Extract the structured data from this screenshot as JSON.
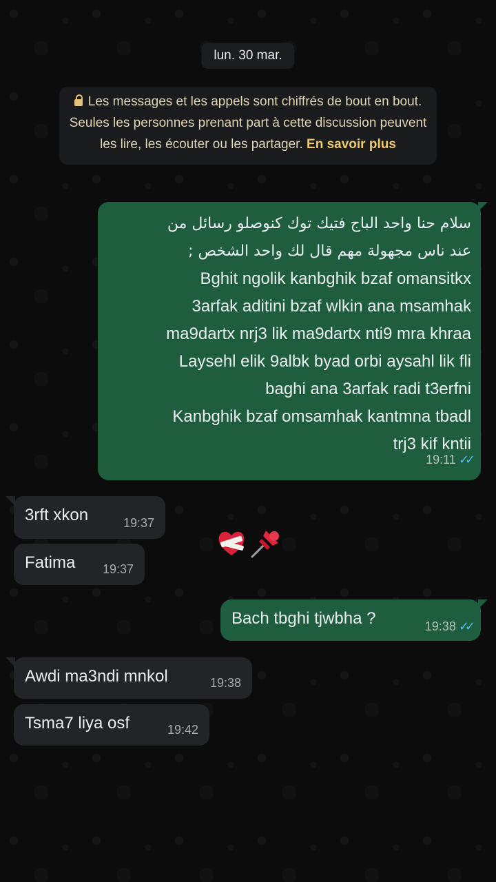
{
  "date_separator": "lun. 30 mar.",
  "encryption_notice": {
    "text": "Les messages et les appels sont chiffrés de bout en bout. Seules les personnes prenant part à cette discussion peuvent les lire, les écouter ou les partager.",
    "link": "En savoir plus"
  },
  "messages": [
    {
      "direction": "outgoing",
      "lines_arabic": [
        "سلام حنا واحد الباج فتيك توك كنوصلو رسائل من",
        "عند ناس مجهولة مهم قال لك واحد الشخص ;"
      ],
      "lines_latin": [
        "Bghit ngolik kanbghik bzaf omansitkx",
        "3arfak aditini bzaf wlkin ana msamhak",
        "ma9dartx nrj3 lik ma9dartx nti9 mra khraa",
        "Laysehl elik 9albk byad orbi aysahl lik fli",
        "baghi ana 3arfak radi t3erfni",
        "Kanbghik bzaf omsamhak kantmna tbadl",
        "trj3 kif kntii"
      ],
      "time": "19:11",
      "status": "read"
    },
    {
      "direction": "incoming",
      "text": "3rft xkon",
      "time": "19:37"
    },
    {
      "direction": "incoming",
      "text": "Fatima",
      "time": "19:37"
    },
    {
      "direction": "outgoing",
      "text": "Bach tbghi tjwbha ?",
      "time": "19:38",
      "status": "read"
    },
    {
      "direction": "incoming",
      "text": "Awdi ma3ndi mnkol",
      "time": "19:38"
    },
    {
      "direction": "incoming",
      "text": "Tsma7 liya osf",
      "time": "19:42"
    }
  ],
  "decorations": {
    "emojis": [
      "mending-heart-icon",
      "pushpin-icon"
    ]
  },
  "colors": {
    "outgoing_bubble": "#1f5d3f",
    "incoming_bubble": "#232427",
    "read_ticks": "#53bdeb",
    "link": "#f0c96a"
  }
}
